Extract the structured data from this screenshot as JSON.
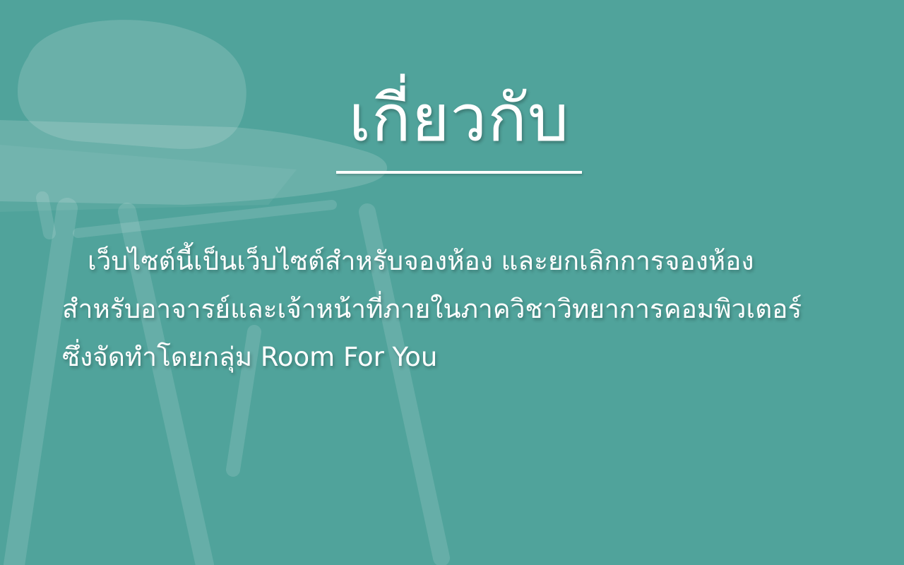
{
  "about": {
    "title": "เกี่ยวกับ",
    "description_lines": [
      "เว็บไซต์นี้เป็นเว็บไซต์สำหรับจองห้อง และยกเลิกการจองห้อง",
      "สำหรับอาจารย์และเจ้าหน้าที่ภายในภาควิชาวิทยาการคอมพิวเตอร์",
      "ซึ่งจัดทำโดยกลุ่ม Room For You"
    ]
  },
  "background": {
    "color": "#50a39b",
    "image_icon": "lecture-chair-icon"
  }
}
